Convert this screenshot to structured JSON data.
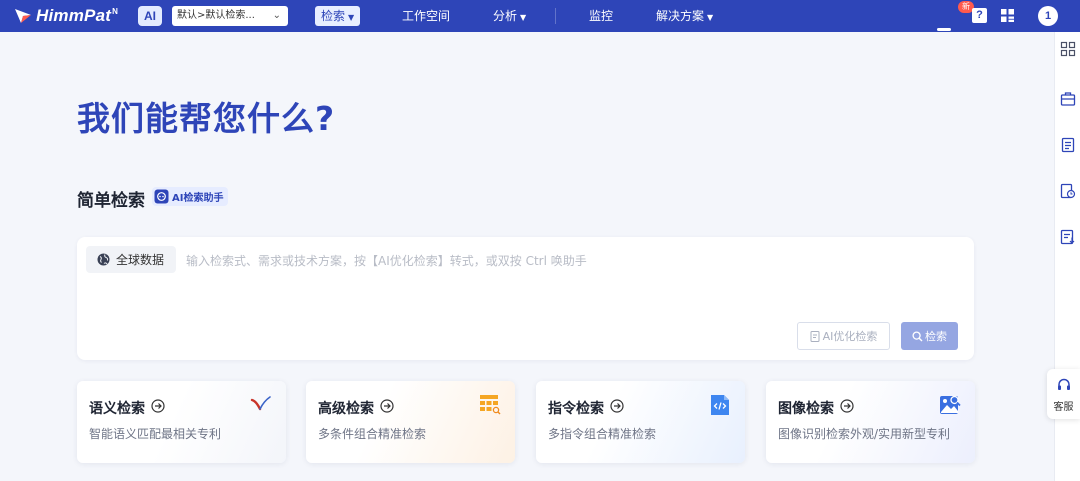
{
  "topbar": {
    "logo_text": "HimmPat",
    "logo_sup": "N",
    "ai_badge": "AI",
    "scope_select": "默认>默认检索...",
    "nav": {
      "search": "检索",
      "workspace": "工作空间",
      "analysis": "分析",
      "monitor": "监控",
      "solutions": "解决方案"
    },
    "new_badge": "新",
    "help_label": "?",
    "notification_count": "1"
  },
  "main": {
    "hero_title": "我们能帮您什么?",
    "simple_search_title": "简单检索",
    "ai_assistant_label": "AI检索助手",
    "search": {
      "global_label": "全球数据",
      "placeholder": "输入检索式、需求或技术方案，按【AI优化检索】转式，或双按 Ctrl 唤助手",
      "value": "",
      "ai_optimize_label": "AI优化检索",
      "search_label": "检索"
    },
    "cards": [
      {
        "title": "语义检索",
        "desc": "智能语义匹配最相关专利",
        "icon": "check-mark-icon"
      },
      {
        "title": "高级检索",
        "desc": "多条件组合精准检索",
        "icon": "table-search-icon"
      },
      {
        "title": "指令检索",
        "desc": "多指令组合精准检索",
        "icon": "code-file-icon"
      },
      {
        "title": "图像检索",
        "desc": "图像识别检索外观/实用新型专利",
        "icon": "image-search-icon"
      }
    ]
  },
  "rail": {
    "service_label": "客服"
  },
  "colors": {
    "brand": "#2e45b8",
    "search_button": "#95a6e2",
    "new_badge": "#ff5a4e"
  }
}
